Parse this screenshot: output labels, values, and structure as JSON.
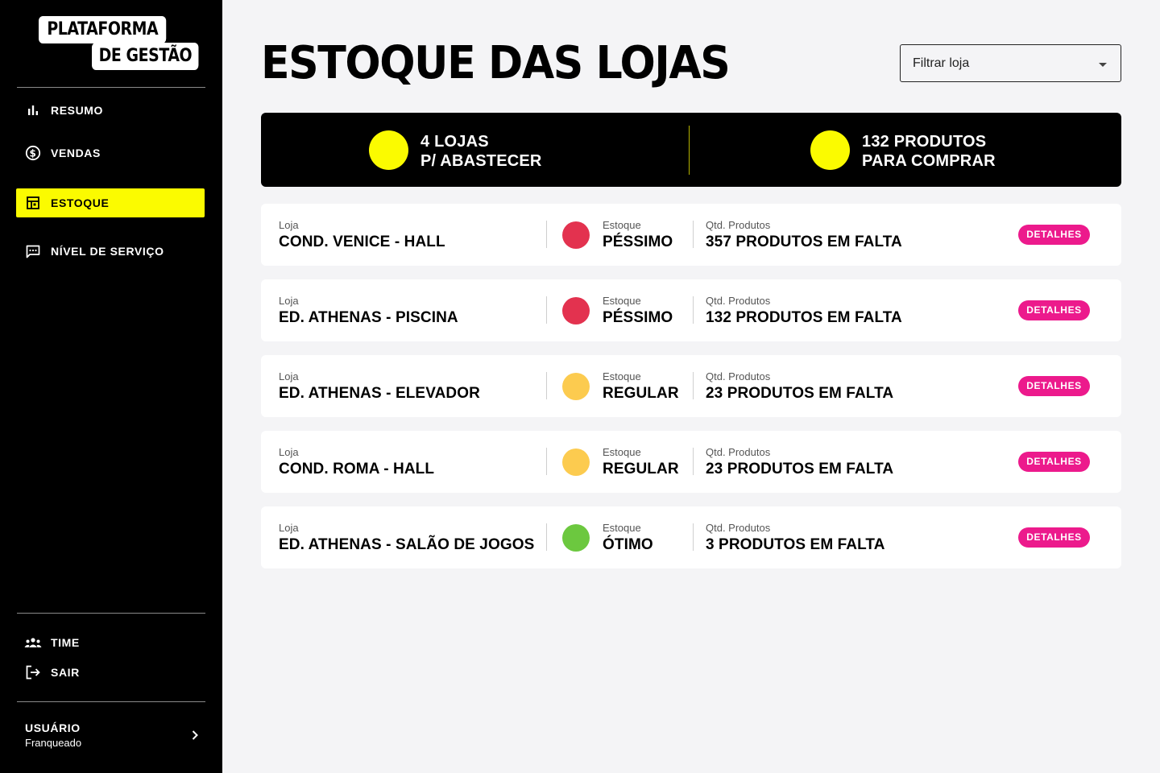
{
  "brand": {
    "line1": "PLATAFORMA",
    "line2": "DE GESTÃO"
  },
  "nav": [
    {
      "label": "RESUMO",
      "icon": "bar-chart-icon",
      "active": false
    },
    {
      "label": "VENDAS",
      "icon": "dollar-circle-icon",
      "active": false
    },
    {
      "label": "ESTOQUE",
      "icon": "inventory-icon",
      "active": true
    },
    {
      "label": "NÍVEL DE SERVIÇO",
      "icon": "chat-icon",
      "active": false
    }
  ],
  "bottom_nav": [
    {
      "label": "TIME",
      "icon": "team-icon"
    },
    {
      "label": "SAIR",
      "icon": "logout-icon"
    }
  ],
  "user": {
    "name": "USUÁRIO",
    "role": "Franqueado"
  },
  "page": {
    "title": "ESTOQUE DAS LOJAS",
    "filter_placeholder": "Filtrar loja"
  },
  "summary": {
    "stores": {
      "line1": "4 LOJAS",
      "line2": "P/ ABASTECER"
    },
    "products": {
      "line1": "132 PRODUTOS",
      "line2": "PARA COMPRAR"
    }
  },
  "labels": {
    "store": "Loja",
    "stock": "Estoque",
    "qty": "Qtd. Produtos",
    "details": "DETALHES"
  },
  "stores": [
    {
      "name": "COND. VENICE - HALL",
      "status": "PÉSSIMO",
      "status_color": "#e3324f",
      "missing": "357 PRODUTOS EM FALTA"
    },
    {
      "name": "ED. ATHENAS - PISCINA",
      "status": "PÉSSIMO",
      "status_color": "#e3324f",
      "missing": "132 PRODUTOS EM FALTA"
    },
    {
      "name": "ED. ATHENAS - ELEVADOR",
      "status": "REGULAR",
      "status_color": "#fccb4f",
      "missing": "23 PRODUTOS EM FALTA"
    },
    {
      "name": "COND. ROMA - HALL",
      "status": "REGULAR",
      "status_color": "#fccb4f",
      "missing": "23 PRODUTOS EM FALTA"
    },
    {
      "name": "ED. ATHENAS - SALÃO DE JOGOS",
      "status": "ÓTIMO",
      "status_color": "#6cc83f",
      "missing": "3 PRODUTOS EM FALTA"
    }
  ],
  "colors": {
    "accent": "#fbfb00",
    "sidebar": "#000000",
    "details_button": "#ec1a8c",
    "background": "#f4f4f6"
  }
}
